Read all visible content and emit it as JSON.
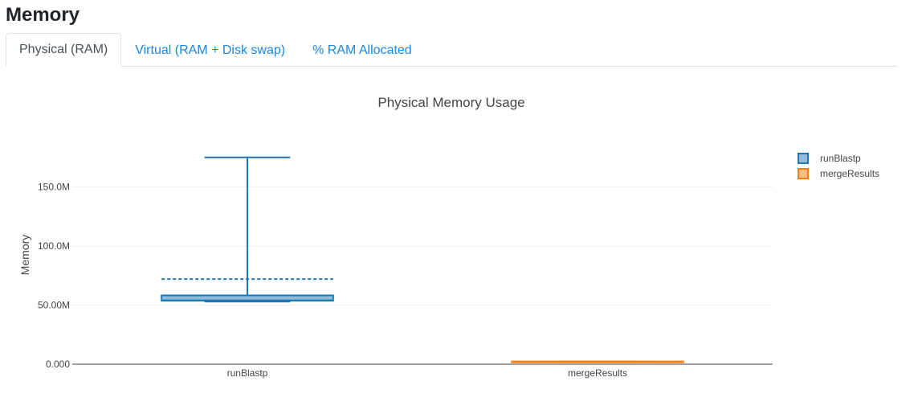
{
  "page": {
    "title": "Memory"
  },
  "tabs": [
    {
      "label": "Physical (RAM)",
      "active": true
    },
    {
      "label": "Virtual (RAM + Disk swap)",
      "active": false
    },
    {
      "label": "% RAM Allocated",
      "active": false
    }
  ],
  "colors": {
    "tab_link": "#1a86e6",
    "series_1": "#1f77b4",
    "series_2": "#ff7f0e",
    "grid": "#eeeeee",
    "axis": "#444444"
  },
  "chart_data": {
    "type": "box",
    "title": "Physical Memory Usage",
    "xlabel": "",
    "ylabel": "Memory",
    "ylim": [
      0,
      200000000
    ],
    "yticks": [
      {
        "value": 0,
        "label": "0.000"
      },
      {
        "value": 50000000,
        "label": "50.00M"
      },
      {
        "value": 100000000,
        "label": "100.0M"
      },
      {
        "value": 150000000,
        "label": "150.0M"
      }
    ],
    "grid": true,
    "legend_position": "top-right",
    "categories": [
      "runBlastp",
      "mergeResults"
    ],
    "series": [
      {
        "name": "runBlastp",
        "color": "#1f77b4",
        "min": 53000000,
        "q1": 53800000,
        "median": 54000000,
        "q3": 58200000,
        "max": 175000000,
        "mean": 72000000
      },
      {
        "name": "mergeResults",
        "color": "#ff7f0e",
        "min": 1800000,
        "q1": 1900000,
        "median": 2000000,
        "q3": 2300000,
        "max": 2400000,
        "mean": 2100000
      }
    ]
  }
}
